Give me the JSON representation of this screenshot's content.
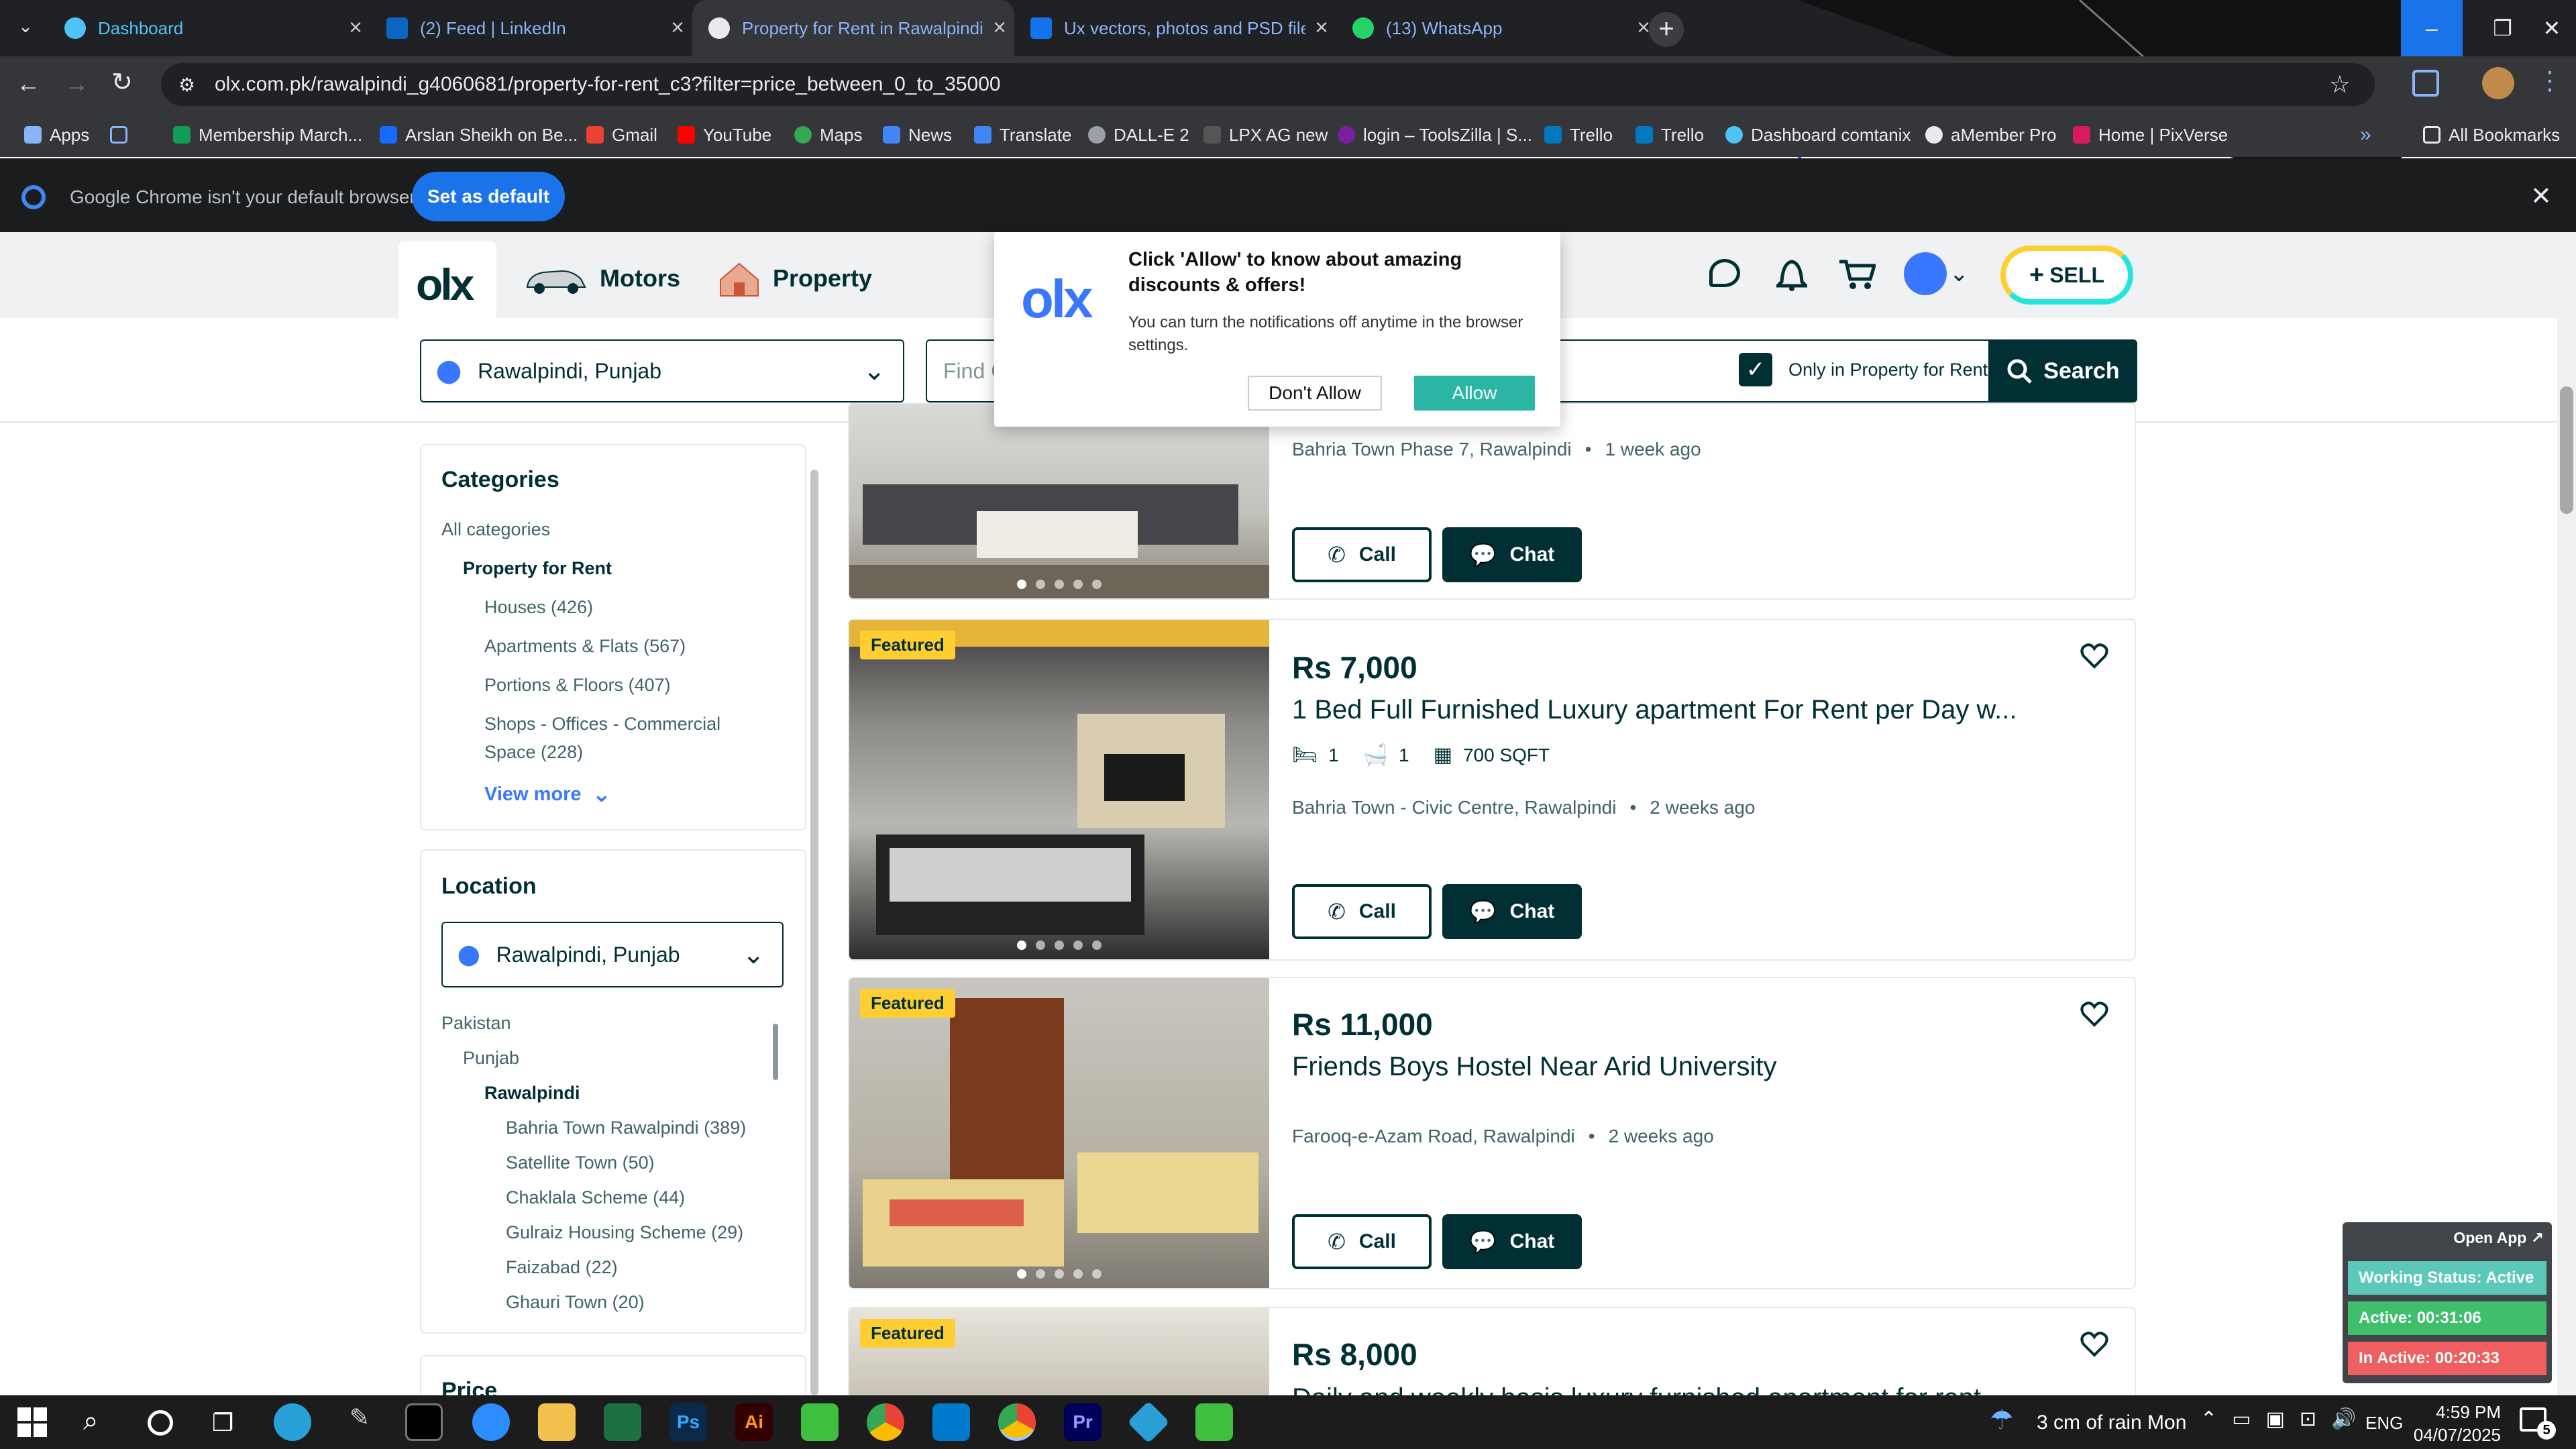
{
  "browser": {
    "tabs": [
      {
        "title": "Dashboard",
        "color": "#4fc3f7"
      },
      {
        "title": "(2) Feed | LinkedIn",
        "color": "#0a66c2"
      },
      {
        "title": "Property for Rent in Rawalpindi",
        "color": "#e8eaed"
      },
      {
        "title": "Ux vectors, photos and PSD file",
        "color": "#1273eb"
      },
      {
        "title": "(13) WhatsApp",
        "color": "#25d366"
      }
    ],
    "url": "olx.com.pk/rawalpindi_g4060681/property-for-rent_c3?filter=price_between_0_to_35000",
    "bookmarks": [
      "Apps",
      "Membership March...",
      "Arslan Sheikh on Be...",
      "Gmail",
      "YouTube",
      "Maps",
      "News",
      "Translate",
      "DALL-E 2",
      "LPX AG new",
      "login – ToolsZilla | S...",
      "Trello",
      "Trello",
      "Dashboard comtanix",
      "aMember Pro",
      "Home | PixVerse"
    ],
    "all_bookmarks": "All Bookmarks",
    "infobar_text": "Google Chrome isn't your default browser",
    "set_default": "Set as default"
  },
  "header": {
    "nav": [
      "Motors",
      "Property"
    ],
    "sell": "SELL",
    "location": "Rawalpindi, Punjab",
    "find_placeholder": "Find C",
    "only_in": "Only in Property for Rent",
    "search": "Search"
  },
  "popup": {
    "title": "Click 'Allow' to know about amazing discounts & offers!",
    "body": "You can turn the notifications off anytime in the browser settings.",
    "dont_allow": "Don't Allow",
    "allow": "Allow"
  },
  "sidebar": {
    "categories_title": "Categories",
    "all_categories": "All categories",
    "current": "Property for Rent",
    "items": [
      "Houses (426)",
      "Apartments & Flats (567)",
      "Portions & Floors (407)",
      "Shops - Offices - Commercial",
      "Space (228)"
    ],
    "view_more": "View more",
    "location_title": "Location",
    "location_value": "Rawalpindi, Punjab",
    "tree": [
      "Pakistan",
      "Punjab",
      "Rawalpindi"
    ],
    "areas": [
      "Bahria Town Rawalpindi (389)",
      "Satellite Town (50)",
      "Chaklala Scheme (44)",
      "Gulraiz Housing Scheme (29)",
      "Faizabad (22)",
      "Ghauri Town (20)"
    ],
    "price_title": "Price"
  },
  "listings": {
    "first_meta": {
      "location": "Bahria Town Phase 7, Rawalpindi",
      "time": "1 week ago"
    },
    "featured": "Featured",
    "call": "Call",
    "chat": "Chat",
    "items": [
      {
        "price": "Rs 7,000",
        "title": "1 Bed Full Furnished Luxury apartment For Rent per Day w...",
        "beds": "1",
        "baths": "1",
        "area": "700 SQFT",
        "location": "Bahria Town - Civic Centre, Rawalpindi",
        "time": "2 weeks ago"
      },
      {
        "price": "Rs 11,000",
        "title": "Friends Boys Hostel Near Arid University",
        "location": "Farooq-e-Azam Road, Rawalpindi",
        "time": "2 weeks ago"
      },
      {
        "price": "Rs 8,000",
        "title": "Daily and weekly basis luxury furnished apartment for rent"
      }
    ]
  },
  "widget": {
    "open_app": "Open App ↗",
    "status": "Working Status: Active",
    "active": "Active: 00:31:06",
    "inactive": "In Active: 00:20:33"
  },
  "taskbar": {
    "weather": "3 cm of rain Mon",
    "lang": "ENG",
    "time": "4:59 PM",
    "date": "04/07/2025",
    "notif_count": "5"
  }
}
